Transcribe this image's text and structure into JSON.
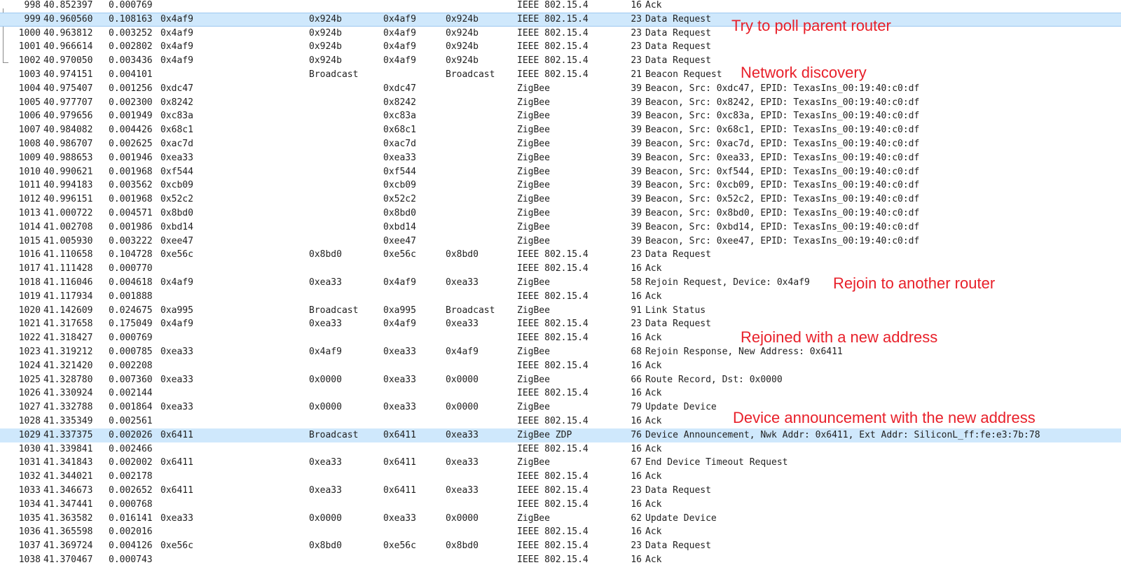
{
  "packets": [
    {
      "no": "998",
      "time": "40.852397",
      "delta": "0.000769",
      "src": "",
      "dst": "",
      "src2": "",
      "dst2": "",
      "proto": "IEEE 802.15.4",
      "len": "16",
      "info": "Ack"
    },
    {
      "no": "999",
      "time": "40.960560",
      "delta": "0.108163",
      "src": "0x4af9",
      "dst": "0x924b",
      "src2": "0x4af9",
      "dst2": "0x924b",
      "proto": "IEEE 802.15.4",
      "len": "23",
      "info": "Data Request",
      "selected": true
    },
    {
      "no": "1000",
      "time": "40.963812",
      "delta": "0.003252",
      "src": "0x4af9",
      "dst": "0x924b",
      "src2": "0x4af9",
      "dst2": "0x924b",
      "proto": "IEEE 802.15.4",
      "len": "23",
      "info": "Data Request"
    },
    {
      "no": "1001",
      "time": "40.966614",
      "delta": "0.002802",
      "src": "0x4af9",
      "dst": "0x924b",
      "src2": "0x4af9",
      "dst2": "0x924b",
      "proto": "IEEE 802.15.4",
      "len": "23",
      "info": "Data Request"
    },
    {
      "no": "1002",
      "time": "40.970050",
      "delta": "0.003436",
      "src": "0x4af9",
      "dst": "0x924b",
      "src2": "0x4af9",
      "dst2": "0x924b",
      "proto": "IEEE 802.15.4",
      "len": "23",
      "info": "Data Request"
    },
    {
      "no": "1003",
      "time": "40.974151",
      "delta": "0.004101",
      "src": "",
      "dst": "Broadcast",
      "src2": "",
      "dst2": "Broadcast",
      "proto": "IEEE 802.15.4",
      "len": "21",
      "info": "Beacon Request"
    },
    {
      "no": "1004",
      "time": "40.975407",
      "delta": "0.001256",
      "src": "0xdc47",
      "dst": "",
      "src2": "0xdc47",
      "dst2": "",
      "proto": "ZigBee",
      "len": "39",
      "info": "Beacon, Src: 0xdc47, EPID: TexasIns_00:19:40:c0:df"
    },
    {
      "no": "1005",
      "time": "40.977707",
      "delta": "0.002300",
      "src": "0x8242",
      "dst": "",
      "src2": "0x8242",
      "dst2": "",
      "proto": "ZigBee",
      "len": "39",
      "info": "Beacon, Src: 0x8242, EPID: TexasIns_00:19:40:c0:df"
    },
    {
      "no": "1006",
      "time": "40.979656",
      "delta": "0.001949",
      "src": "0xc83a",
      "dst": "",
      "src2": "0xc83a",
      "dst2": "",
      "proto": "ZigBee",
      "len": "39",
      "info": "Beacon, Src: 0xc83a, EPID: TexasIns_00:19:40:c0:df"
    },
    {
      "no": "1007",
      "time": "40.984082",
      "delta": "0.004426",
      "src": "0x68c1",
      "dst": "",
      "src2": "0x68c1",
      "dst2": "",
      "proto": "ZigBee",
      "len": "39",
      "info": "Beacon, Src: 0x68c1, EPID: TexasIns_00:19:40:c0:df"
    },
    {
      "no": "1008",
      "time": "40.986707",
      "delta": "0.002625",
      "src": "0xac7d",
      "dst": "",
      "src2": "0xac7d",
      "dst2": "",
      "proto": "ZigBee",
      "len": "39",
      "info": "Beacon, Src: 0xac7d, EPID: TexasIns_00:19:40:c0:df"
    },
    {
      "no": "1009",
      "time": "40.988653",
      "delta": "0.001946",
      "src": "0xea33",
      "dst": "",
      "src2": "0xea33",
      "dst2": "",
      "proto": "ZigBee",
      "len": "39",
      "info": "Beacon, Src: 0xea33, EPID: TexasIns_00:19:40:c0:df"
    },
    {
      "no": "1010",
      "time": "40.990621",
      "delta": "0.001968",
      "src": "0xf544",
      "dst": "",
      "src2": "0xf544",
      "dst2": "",
      "proto": "ZigBee",
      "len": "39",
      "info": "Beacon, Src: 0xf544, EPID: TexasIns_00:19:40:c0:df"
    },
    {
      "no": "1011",
      "time": "40.994183",
      "delta": "0.003562",
      "src": "0xcb09",
      "dst": "",
      "src2": "0xcb09",
      "dst2": "",
      "proto": "ZigBee",
      "len": "39",
      "info": "Beacon, Src: 0xcb09, EPID: TexasIns_00:19:40:c0:df"
    },
    {
      "no": "1012",
      "time": "40.996151",
      "delta": "0.001968",
      "src": "0x52c2",
      "dst": "",
      "src2": "0x52c2",
      "dst2": "",
      "proto": "ZigBee",
      "len": "39",
      "info": "Beacon, Src: 0x52c2, EPID: TexasIns_00:19:40:c0:df"
    },
    {
      "no": "1013",
      "time": "41.000722",
      "delta": "0.004571",
      "src": "0x8bd0",
      "dst": "",
      "src2": "0x8bd0",
      "dst2": "",
      "proto": "ZigBee",
      "len": "39",
      "info": "Beacon, Src: 0x8bd0, EPID: TexasIns_00:19:40:c0:df"
    },
    {
      "no": "1014",
      "time": "41.002708",
      "delta": "0.001986",
      "src": "0xbd14",
      "dst": "",
      "src2": "0xbd14",
      "dst2": "",
      "proto": "ZigBee",
      "len": "39",
      "info": "Beacon, Src: 0xbd14, EPID: TexasIns_00:19:40:c0:df"
    },
    {
      "no": "1015",
      "time": "41.005930",
      "delta": "0.003222",
      "src": "0xee47",
      "dst": "",
      "src2": "0xee47",
      "dst2": "",
      "proto": "ZigBee",
      "len": "39",
      "info": "Beacon, Src: 0xee47, EPID: TexasIns_00:19:40:c0:df"
    },
    {
      "no": "1016",
      "time": "41.110658",
      "delta": "0.104728",
      "src": "0xe56c",
      "dst": "0x8bd0",
      "src2": "0xe56c",
      "dst2": "0x8bd0",
      "proto": "IEEE 802.15.4",
      "len": "23",
      "info": "Data Request"
    },
    {
      "no": "1017",
      "time": "41.111428",
      "delta": "0.000770",
      "src": "",
      "dst": "",
      "src2": "",
      "dst2": "",
      "proto": "IEEE 802.15.4",
      "len": "16",
      "info": "Ack"
    },
    {
      "no": "1018",
      "time": "41.116046",
      "delta": "0.004618",
      "src": "0x4af9",
      "dst": "0xea33",
      "src2": "0x4af9",
      "dst2": "0xea33",
      "proto": "ZigBee",
      "len": "58",
      "info": "Rejoin Request, Device: 0x4af9"
    },
    {
      "no": "1019",
      "time": "41.117934",
      "delta": "0.001888",
      "src": "",
      "dst": "",
      "src2": "",
      "dst2": "",
      "proto": "IEEE 802.15.4",
      "len": "16",
      "info": "Ack"
    },
    {
      "no": "1020",
      "time": "41.142609",
      "delta": "0.024675",
      "src": "0xa995",
      "dst": "Broadcast",
      "src2": "0xa995",
      "dst2": "Broadcast",
      "proto": "ZigBee",
      "len": "91",
      "info": "Link Status"
    },
    {
      "no": "1021",
      "time": "41.317658",
      "delta": "0.175049",
      "src": "0x4af9",
      "dst": "0xea33",
      "src2": "0x4af9",
      "dst2": "0xea33",
      "proto": "IEEE 802.15.4",
      "len": "23",
      "info": "Data Request"
    },
    {
      "no": "1022",
      "time": "41.318427",
      "delta": "0.000769",
      "src": "",
      "dst": "",
      "src2": "",
      "dst2": "",
      "proto": "IEEE 802.15.4",
      "len": "16",
      "info": "Ack"
    },
    {
      "no": "1023",
      "time": "41.319212",
      "delta": "0.000785",
      "src": "0xea33",
      "dst": "0x4af9",
      "src2": "0xea33",
      "dst2": "0x4af9",
      "proto": "ZigBee",
      "len": "68",
      "info": "Rejoin Response, New Address: 0x6411"
    },
    {
      "no": "1024",
      "time": "41.321420",
      "delta": "0.002208",
      "src": "",
      "dst": "",
      "src2": "",
      "dst2": "",
      "proto": "IEEE 802.15.4",
      "len": "16",
      "info": "Ack"
    },
    {
      "no": "1025",
      "time": "41.328780",
      "delta": "0.007360",
      "src": "0xea33",
      "dst": "0x0000",
      "src2": "0xea33",
      "dst2": "0x0000",
      "proto": "ZigBee",
      "len": "66",
      "info": "Route Record, Dst: 0x0000"
    },
    {
      "no": "1026",
      "time": "41.330924",
      "delta": "0.002144",
      "src": "",
      "dst": "",
      "src2": "",
      "dst2": "",
      "proto": "IEEE 802.15.4",
      "len": "16",
      "info": "Ack"
    },
    {
      "no": "1027",
      "time": "41.332788",
      "delta": "0.001864",
      "src": "0xea33",
      "dst": "0x0000",
      "src2": "0xea33",
      "dst2": "0x0000",
      "proto": "ZigBee",
      "len": "79",
      "info": "Update Device"
    },
    {
      "no": "1028",
      "time": "41.335349",
      "delta": "0.002561",
      "src": "",
      "dst": "",
      "src2": "",
      "dst2": "",
      "proto": "IEEE 802.15.4",
      "len": "16",
      "info": "Ack"
    },
    {
      "no": "1029",
      "time": "41.337375",
      "delta": "0.002026",
      "src": "0x6411",
      "dst": "Broadcast",
      "src2": "0x6411",
      "dst2": "0xea33",
      "proto": "ZigBee ZDP",
      "len": "76",
      "info": "Device Announcement, Nwk Addr: 0x6411, Ext Addr: SiliconL_ff:fe:e3:7b:78",
      "highlighted": true
    },
    {
      "no": "1030",
      "time": "41.339841",
      "delta": "0.002466",
      "src": "",
      "dst": "",
      "src2": "",
      "dst2": "",
      "proto": "IEEE 802.15.4",
      "len": "16",
      "info": "Ack"
    },
    {
      "no": "1031",
      "time": "41.341843",
      "delta": "0.002002",
      "src": "0x6411",
      "dst": "0xea33",
      "src2": "0x6411",
      "dst2": "0xea33",
      "proto": "ZigBee",
      "len": "67",
      "info": "End Device Timeout Request"
    },
    {
      "no": "1032",
      "time": "41.344021",
      "delta": "0.002178",
      "src": "",
      "dst": "",
      "src2": "",
      "dst2": "",
      "proto": "IEEE 802.15.4",
      "len": "16",
      "info": "Ack"
    },
    {
      "no": "1033",
      "time": "41.346673",
      "delta": "0.002652",
      "src": "0x6411",
      "dst": "0xea33",
      "src2": "0x6411",
      "dst2": "0xea33",
      "proto": "IEEE 802.15.4",
      "len": "23",
      "info": "Data Request"
    },
    {
      "no": "1034",
      "time": "41.347441",
      "delta": "0.000768",
      "src": "",
      "dst": "",
      "src2": "",
      "dst2": "",
      "proto": "IEEE 802.15.4",
      "len": "16",
      "info": "Ack"
    },
    {
      "no": "1035",
      "time": "41.363582",
      "delta": "0.016141",
      "src": "0xea33",
      "dst": "0x0000",
      "src2": "0xea33",
      "dst2": "0x0000",
      "proto": "ZigBee",
      "len": "62",
      "info": "Update Device"
    },
    {
      "no": "1036",
      "time": "41.365598",
      "delta": "0.002016",
      "src": "",
      "dst": "",
      "src2": "",
      "dst2": "",
      "proto": "IEEE 802.15.4",
      "len": "16",
      "info": "Ack"
    },
    {
      "no": "1037",
      "time": "41.369724",
      "delta": "0.004126",
      "src": "0xe56c",
      "dst": "0x8bd0",
      "src2": "0xe56c",
      "dst2": "0x8bd0",
      "proto": "IEEE 802.15.4",
      "len": "23",
      "info": "Data Request"
    },
    {
      "no": "1038",
      "time": "41.370467",
      "delta": "0.000743",
      "src": "",
      "dst": "",
      "src2": "",
      "dst2": "",
      "proto": "IEEE 802.15.4",
      "len": "16",
      "info": "Ack"
    }
  ],
  "annotations": {
    "poll_parent": "Try to poll parent router",
    "network_discovery": "Network discovery",
    "rejoin_router": "Rejoin to another router",
    "rejoined_address": "Rejoined with a new address",
    "device_announcement": "Device announcement with the new address"
  },
  "colors": {
    "selected_row": "#cfe8fc",
    "annotation_text": "#e8202a"
  }
}
